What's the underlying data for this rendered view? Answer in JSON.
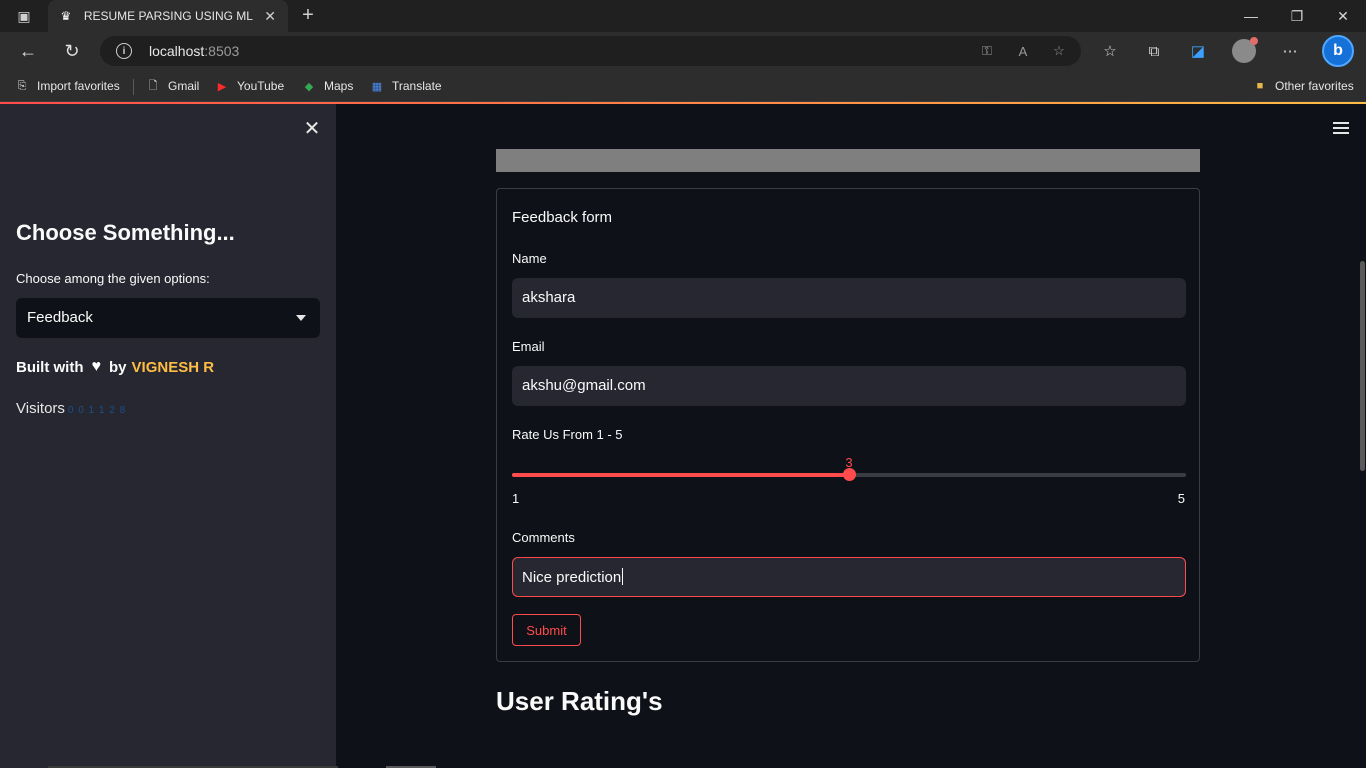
{
  "browser": {
    "tab_title": "RESUME PARSING USING ML AN",
    "url_host": "localhost",
    "url_port": ":8503",
    "bookmarks": [
      {
        "label": "Import favorites",
        "icon": "import-icon"
      },
      {
        "label": "Gmail",
        "icon": "page-icon"
      },
      {
        "label": "YouTube",
        "icon": "youtube-icon"
      },
      {
        "label": "Maps",
        "icon": "maps-icon"
      },
      {
        "label": "Translate",
        "icon": "translate-icon"
      }
    ],
    "other_favorites": "Other favorites"
  },
  "sidebar": {
    "heading": "Choose Something...",
    "select_label": "Choose among the given options:",
    "select_value": "Feedback",
    "built_with": "Built with",
    "by": "by",
    "author": "VIGNESH R",
    "visitors_label": "Visitors",
    "visitor_counter": "0 0 1 1 2 8"
  },
  "form": {
    "title": "Feedback form",
    "name_label": "Name",
    "name_value": "akshara",
    "email_label": "Email",
    "email_value": "akshu@gmail.com",
    "rating_label": "Rate Us From 1 - 5",
    "rating_value": 3,
    "rating_value_text": "3",
    "rating_min": "1",
    "rating_max": "5",
    "comments_label": "Comments",
    "comments_value": "Nice prediction",
    "submit_label": "Submit"
  },
  "ratings": {
    "heading": "User Rating's"
  },
  "colors": {
    "accent": "#ff4b4b",
    "author": "#ffbd45",
    "background": "#0e1117",
    "sidebar": "#262730"
  }
}
